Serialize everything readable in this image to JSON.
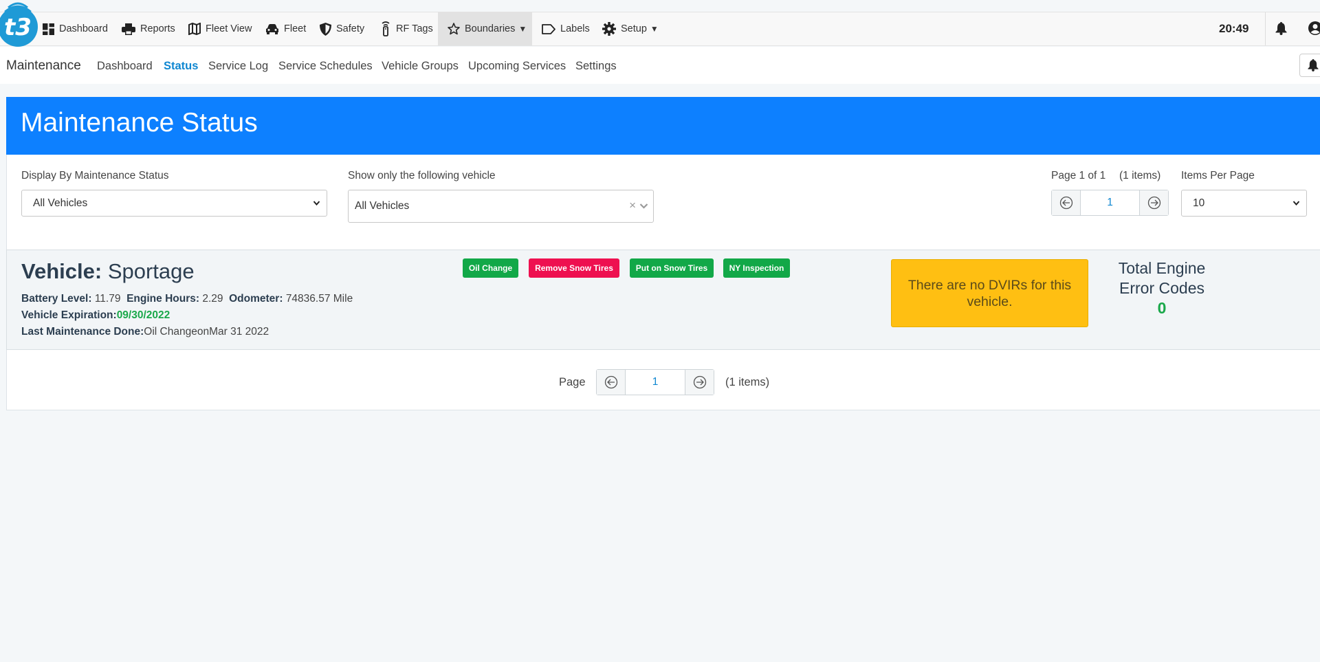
{
  "topnav": {
    "items": [
      {
        "label": "Dashboard"
      },
      {
        "label": "Reports"
      },
      {
        "label": "Fleet View"
      },
      {
        "label": "Fleet"
      },
      {
        "label": "Safety"
      },
      {
        "label": "RF Tags"
      },
      {
        "label": "Boundaries"
      },
      {
        "label": "Labels"
      },
      {
        "label": "Setup"
      }
    ],
    "clock": "20:49"
  },
  "subnav": {
    "title": "Maintenance",
    "links": [
      "Dashboard",
      "Status",
      "Service Log",
      "Service Schedules",
      "Vehicle Groups",
      "Upcoming Services",
      "Settings"
    ],
    "active": "Status"
  },
  "page": {
    "title": "Maintenance Status"
  },
  "filters": {
    "status_label": "Display By Maintenance Status",
    "status_value": "All Vehicles",
    "vehicle_label": "Show only the following vehicle",
    "vehicle_value": "All Vehicles",
    "page_info": "Page 1 of 1",
    "items_info": "(1 items)",
    "page_number": "1",
    "per_page_label": "Items Per Page",
    "per_page_value": "10"
  },
  "vehicle": {
    "label": "Vehicle:",
    "name": "Sportage",
    "battery_label": "Battery Level:",
    "battery": "11.79",
    "engine_hours_label": "Engine Hours:",
    "engine_hours": "2.29",
    "odometer_label": "Odometer:",
    "odometer": "74836.57 Mile",
    "expiration_label": "Vehicle Expiration:",
    "expiration": "09/30/2022",
    "last_maint_label": "Last Maintenance Done:",
    "last_maint": "Oil ChangeonMar 31 2022",
    "tags": [
      {
        "label": "Oil Change",
        "color": "#12a848"
      },
      {
        "label": "Remove Snow Tires",
        "color": "#ee1050"
      },
      {
        "label": "Put on Snow Tires",
        "color": "#12a848"
      },
      {
        "label": "NY Inspection",
        "color": "#12a848"
      }
    ],
    "dvir_message": "There are no DVIRs for this vehicle.",
    "engine_codes_title": "Total Engine Error Codes",
    "engine_codes_count": "0"
  },
  "bottom_pager": {
    "label": "Page",
    "page_number": "1",
    "items_info": "(1 items)"
  },
  "colors": {
    "banner": "#0d80ff",
    "active_link": "#0f87d1",
    "success": "#12a848",
    "danger": "#ee1050",
    "warning": "#ffbf12"
  }
}
